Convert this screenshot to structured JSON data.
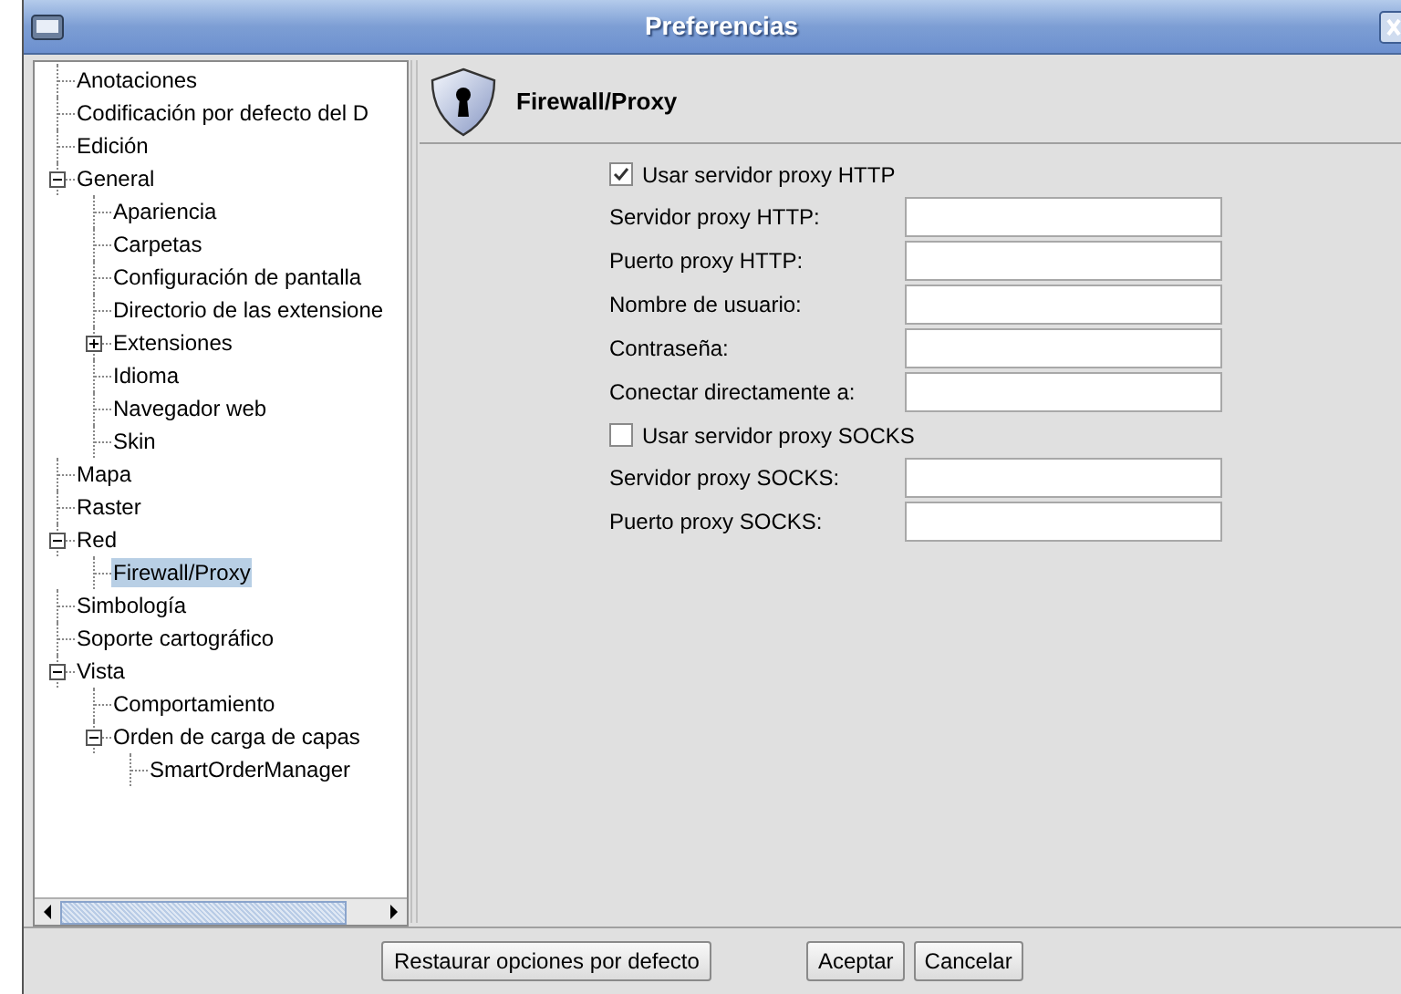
{
  "window": {
    "title": "Preferencias"
  },
  "tree": [
    {
      "label": "Anotaciones",
      "kind": "leaf",
      "selected": false
    },
    {
      "label": "Codificación por defecto del D",
      "kind": "leaf",
      "selected": false
    },
    {
      "label": "Edición",
      "kind": "leaf",
      "selected": false
    },
    {
      "label": "General",
      "kind": "branch",
      "expanded": true,
      "selected": false,
      "children": [
        {
          "label": "Apariencia",
          "kind": "leaf",
          "selected": false
        },
        {
          "label": "Carpetas",
          "kind": "leaf",
          "selected": false
        },
        {
          "label": "Configuración de pantalla",
          "kind": "leaf",
          "selected": false
        },
        {
          "label": "Directorio de las extensione",
          "kind": "leaf",
          "selected": false
        },
        {
          "label": "Extensiones",
          "kind": "branch",
          "expanded": false,
          "selected": false
        },
        {
          "label": "Idioma",
          "kind": "leaf",
          "selected": false
        },
        {
          "label": "Navegador web",
          "kind": "leaf",
          "selected": false
        },
        {
          "label": "Skin",
          "kind": "leaf",
          "selected": false
        }
      ]
    },
    {
      "label": "Mapa",
      "kind": "leaf",
      "selected": false
    },
    {
      "label": "Raster",
      "kind": "leaf",
      "selected": false
    },
    {
      "label": "Red",
      "kind": "branch",
      "expanded": true,
      "selected": false,
      "children": [
        {
          "label": "Firewall/Proxy",
          "kind": "leaf",
          "selected": true
        }
      ]
    },
    {
      "label": "Simbología",
      "kind": "leaf",
      "selected": false
    },
    {
      "label": "Soporte cartográfico",
      "kind": "leaf",
      "selected": false
    },
    {
      "label": "Vista",
      "kind": "branch",
      "expanded": true,
      "selected": false,
      "children": [
        {
          "label": "Comportamiento",
          "kind": "leaf",
          "selected": false
        },
        {
          "label": "Orden de carga de capas",
          "kind": "branch",
          "expanded": true,
          "selected": false,
          "children": [
            {
              "label": "SmartOrderManager",
              "kind": "leaf",
              "selected": false
            }
          ]
        }
      ]
    }
  ],
  "panel": {
    "title": "Firewall/Proxy",
    "form": [
      {
        "kind": "checkbox",
        "label": "Usar servidor proxy HTTP",
        "checked": true
      },
      {
        "kind": "field",
        "label": "Servidor proxy HTTP:"
      },
      {
        "kind": "field",
        "label": "Puerto proxy HTTP:"
      },
      {
        "kind": "field",
        "label": "Nombre de usuario:"
      },
      {
        "kind": "field",
        "label": "Contraseña:"
      },
      {
        "kind": "field",
        "label": "Conectar directamente a:"
      },
      {
        "kind": "checkbox",
        "label": "Usar servidor proxy SOCKS",
        "checked": false
      },
      {
        "kind": "field",
        "label": "Servidor proxy SOCKS:"
      },
      {
        "kind": "field",
        "label": "Puerto proxy SOCKS:"
      }
    ]
  },
  "buttons": {
    "restore": "Restaurar opciones por defecto",
    "accept": "Aceptar",
    "cancel": "Cancelar"
  }
}
